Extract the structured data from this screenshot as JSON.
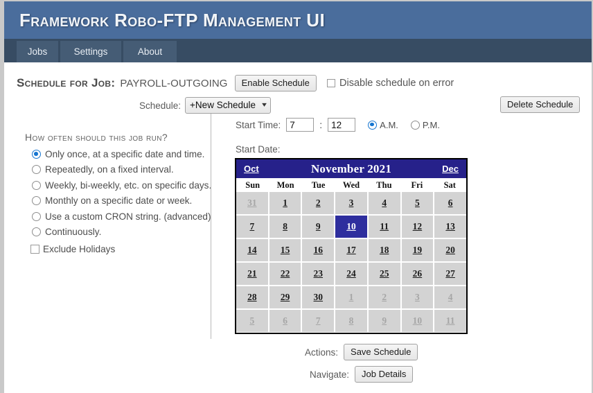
{
  "app": {
    "title": "Framework Robo-FTP Management UI",
    "header_bg": "#4a6d9c",
    "tabbar_bg": "#374c63"
  },
  "tabs": [
    {
      "label": "Jobs"
    },
    {
      "label": "Settings"
    },
    {
      "label": "About"
    }
  ],
  "schedule_header": {
    "heading": "Schedule for Job:",
    "job_name": "PAYROLL-OUTGOING",
    "enable_button": "Enable Schedule",
    "disable_on_error_label": "Disable schedule on error",
    "disable_on_error_checked": false
  },
  "schedule_select": {
    "label": "Schedule:",
    "value": "+New Schedule",
    "caret": "chevron-down-icon"
  },
  "delete_button": {
    "label": "Delete Schedule"
  },
  "frequency": {
    "title": "How often should this job run?",
    "options": [
      {
        "label": "Only once, at a specific date and time.",
        "selected": true
      },
      {
        "label": "Repeatedly, on a fixed interval.",
        "selected": false
      },
      {
        "label": "Weekly, bi-weekly, etc. on specific days.",
        "selected": false
      },
      {
        "label": "Monthly on a specific date or week.",
        "selected": false
      },
      {
        "label": "Use a custom CRON string. (advanced)",
        "selected": false
      },
      {
        "label": "Continuously.",
        "selected": false
      }
    ],
    "exclude_holidays_label": "Exclude Holidays",
    "exclude_holidays_checked": false
  },
  "start_time": {
    "label": "Start Time:",
    "hour": "7",
    "minute": "12",
    "separator": ":",
    "am_label": "A.M.",
    "pm_label": "P.M.",
    "meridiem_selected": "A.M."
  },
  "start_date": {
    "label": "Start Date:",
    "calendar": {
      "prev_label": "Oct",
      "next_label": "Dec",
      "title": "November 2021",
      "header_bg": "#26218a",
      "selected_bg": "#2e2e9e",
      "day_names": [
        "Sun",
        "Mon",
        "Tue",
        "Wed",
        "Thu",
        "Fri",
        "Sat"
      ],
      "selected_day": 10,
      "weeks": [
        [
          {
            "d": "31",
            "other": true
          },
          {
            "d": "1"
          },
          {
            "d": "2"
          },
          {
            "d": "3"
          },
          {
            "d": "4"
          },
          {
            "d": "5"
          },
          {
            "d": "6"
          }
        ],
        [
          {
            "d": "7"
          },
          {
            "d": "8"
          },
          {
            "d": "9"
          },
          {
            "d": "10",
            "selected": true
          },
          {
            "d": "11"
          },
          {
            "d": "12"
          },
          {
            "d": "13"
          }
        ],
        [
          {
            "d": "14"
          },
          {
            "d": "15"
          },
          {
            "d": "16"
          },
          {
            "d": "17"
          },
          {
            "d": "18"
          },
          {
            "d": "19"
          },
          {
            "d": "20"
          }
        ],
        [
          {
            "d": "21"
          },
          {
            "d": "22"
          },
          {
            "d": "23"
          },
          {
            "d": "24"
          },
          {
            "d": "25"
          },
          {
            "d": "26"
          },
          {
            "d": "27"
          }
        ],
        [
          {
            "d": "28"
          },
          {
            "d": "29"
          },
          {
            "d": "30"
          },
          {
            "d": "1",
            "other": true
          },
          {
            "d": "2",
            "other": true
          },
          {
            "d": "3",
            "other": true
          },
          {
            "d": "4",
            "other": true
          }
        ],
        [
          {
            "d": "5",
            "other": true
          },
          {
            "d": "6",
            "other": true
          },
          {
            "d": "7",
            "other": true
          },
          {
            "d": "8",
            "other": true
          },
          {
            "d": "9",
            "other": true
          },
          {
            "d": "10",
            "other": true
          },
          {
            "d": "11",
            "other": true
          }
        ]
      ]
    }
  },
  "footer": {
    "actions_label": "Actions:",
    "save_button": "Save Schedule",
    "navigate_label": "Navigate:",
    "job_details_button": "Job Details"
  }
}
